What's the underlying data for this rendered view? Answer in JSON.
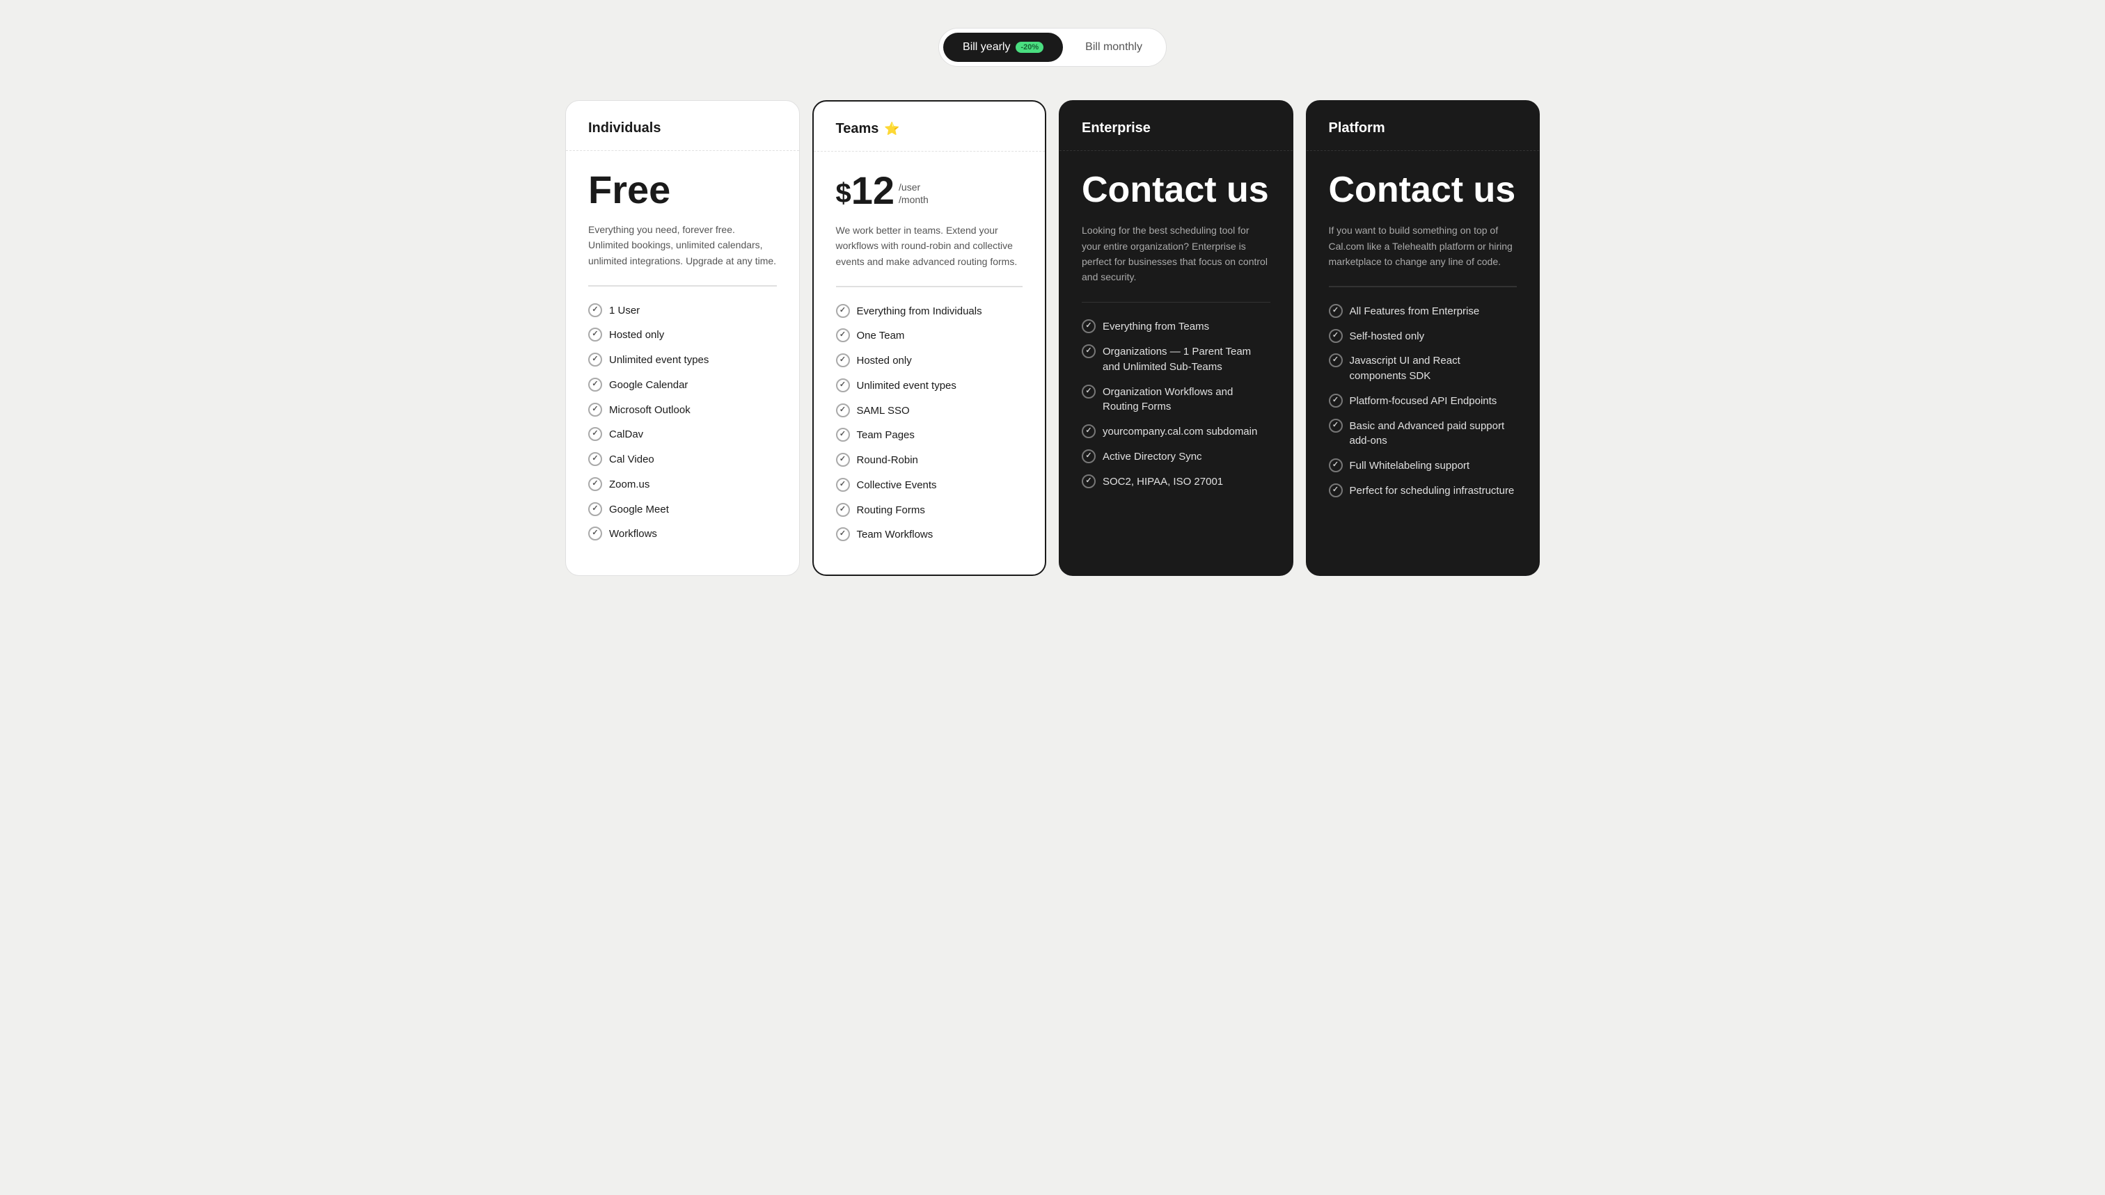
{
  "billing": {
    "yearly_label": "Bill yearly",
    "yearly_discount": "-20%",
    "monthly_label": "Bill monthly",
    "active": "yearly"
  },
  "plans": [
    {
      "id": "individuals",
      "name": "Individuals",
      "theme": "light",
      "star": false,
      "price_type": "free",
      "price_label": "Free",
      "description": "Everything you need, forever free. Unlimited bookings, unlimited calendars, unlimited integrations. Upgrade at any time.",
      "features": [
        "1 User",
        "Hosted only",
        "Unlimited event types",
        "Google Calendar",
        "Microsoft Outlook",
        "CalDav",
        "Cal Video",
        "Zoom.us",
        "Google Meet",
        "Workflows"
      ]
    },
    {
      "id": "teams",
      "name": "Teams",
      "theme": "teams",
      "star": true,
      "price_type": "paid",
      "price_dollar": "$",
      "price_amount": "12",
      "price_per_line1": "/user",
      "price_per_line2": "/month",
      "description": "We work better in teams. Extend your workflows with round-robin and collective events and make advanced routing forms.",
      "features": [
        "Everything from Individuals",
        "One Team",
        "Hosted only",
        "Unlimited event types",
        "SAML SSO",
        "Team Pages",
        "Round-Robin",
        "Collective Events",
        "Routing Forms",
        "Team Workflows"
      ]
    },
    {
      "id": "enterprise",
      "name": "Enterprise",
      "theme": "dark",
      "star": false,
      "price_type": "contact",
      "price_label": "Contact us",
      "description": "Looking for the best scheduling tool for your entire organization? Enterprise is perfect for businesses that focus on control and security.",
      "features": [
        "Everything from Teams",
        "Organizations — 1 Parent Team and Unlimited Sub-Teams",
        "Organization Workflows and Routing Forms",
        "yourcompany.cal.com subdomain",
        "Active Directory Sync",
        "SOC2, HIPAA, ISO 27001"
      ]
    },
    {
      "id": "platform",
      "name": "Platform",
      "theme": "dark",
      "star": false,
      "price_type": "contact",
      "price_label": "Contact us",
      "description": "If you want to build something on top of Cal.com like a Telehealth platform or hiring marketplace to change any line of code.",
      "features": [
        "All Features from Enterprise",
        "Self-hosted only",
        "Javascript UI and React components SDK",
        "Platform-focused API Endpoints",
        "Basic and Advanced paid support add-ons",
        "Full Whitelabeling support",
        "Perfect for scheduling infrastructure"
      ]
    }
  ]
}
